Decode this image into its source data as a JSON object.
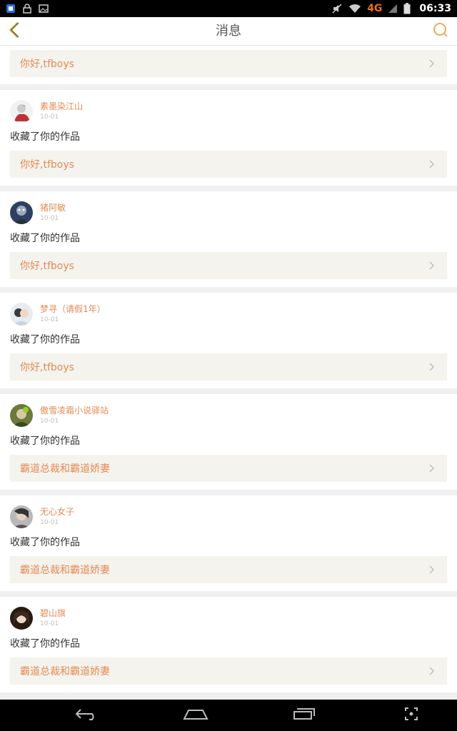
{
  "status_bar": {
    "network": "4G",
    "time": "06:33"
  },
  "header": {
    "title": "消息"
  },
  "top_partial": {
    "work_title": "你好,tfboys"
  },
  "messages": [
    {
      "username": "素墨染江山",
      "date": "10-01",
      "action": "收藏了你的作品",
      "work_title": "你好,tfboys",
      "avatar_color": "#d9d9d9"
    },
    {
      "username": "猪阿敏",
      "date": "10-01",
      "action": "收藏了你的作品",
      "work_title": "你好,tfboys",
      "avatar_color": "#2f3f63"
    },
    {
      "username": "梦寻（请假1年）",
      "date": "10-01",
      "action": "收藏了你的作品",
      "work_title": "你好,tfboys",
      "avatar_color": "#c9d3dc"
    },
    {
      "username": "傲雪凌霜小说驿站",
      "date": "10-01",
      "action": "收藏了你的作品",
      "work_title": "霸道总裁和霸道娇妻",
      "avatar_color": "#4a5a2a"
    },
    {
      "username": "无心女子",
      "date": "10-01",
      "action": "收藏了你的作品",
      "work_title": "霸道总裁和霸道娇妻",
      "avatar_color": "#8a8a8a"
    },
    {
      "username": "碧山旗",
      "date": "10-01",
      "action": "收藏了你的作品",
      "work_title": "霸道总裁和霸道娇妻",
      "avatar_color": "#3a2a22"
    }
  ],
  "colors": {
    "accent": "#e38b55",
    "link_bg": "#f4f3ee",
    "back_arrow": "#c8a020"
  }
}
